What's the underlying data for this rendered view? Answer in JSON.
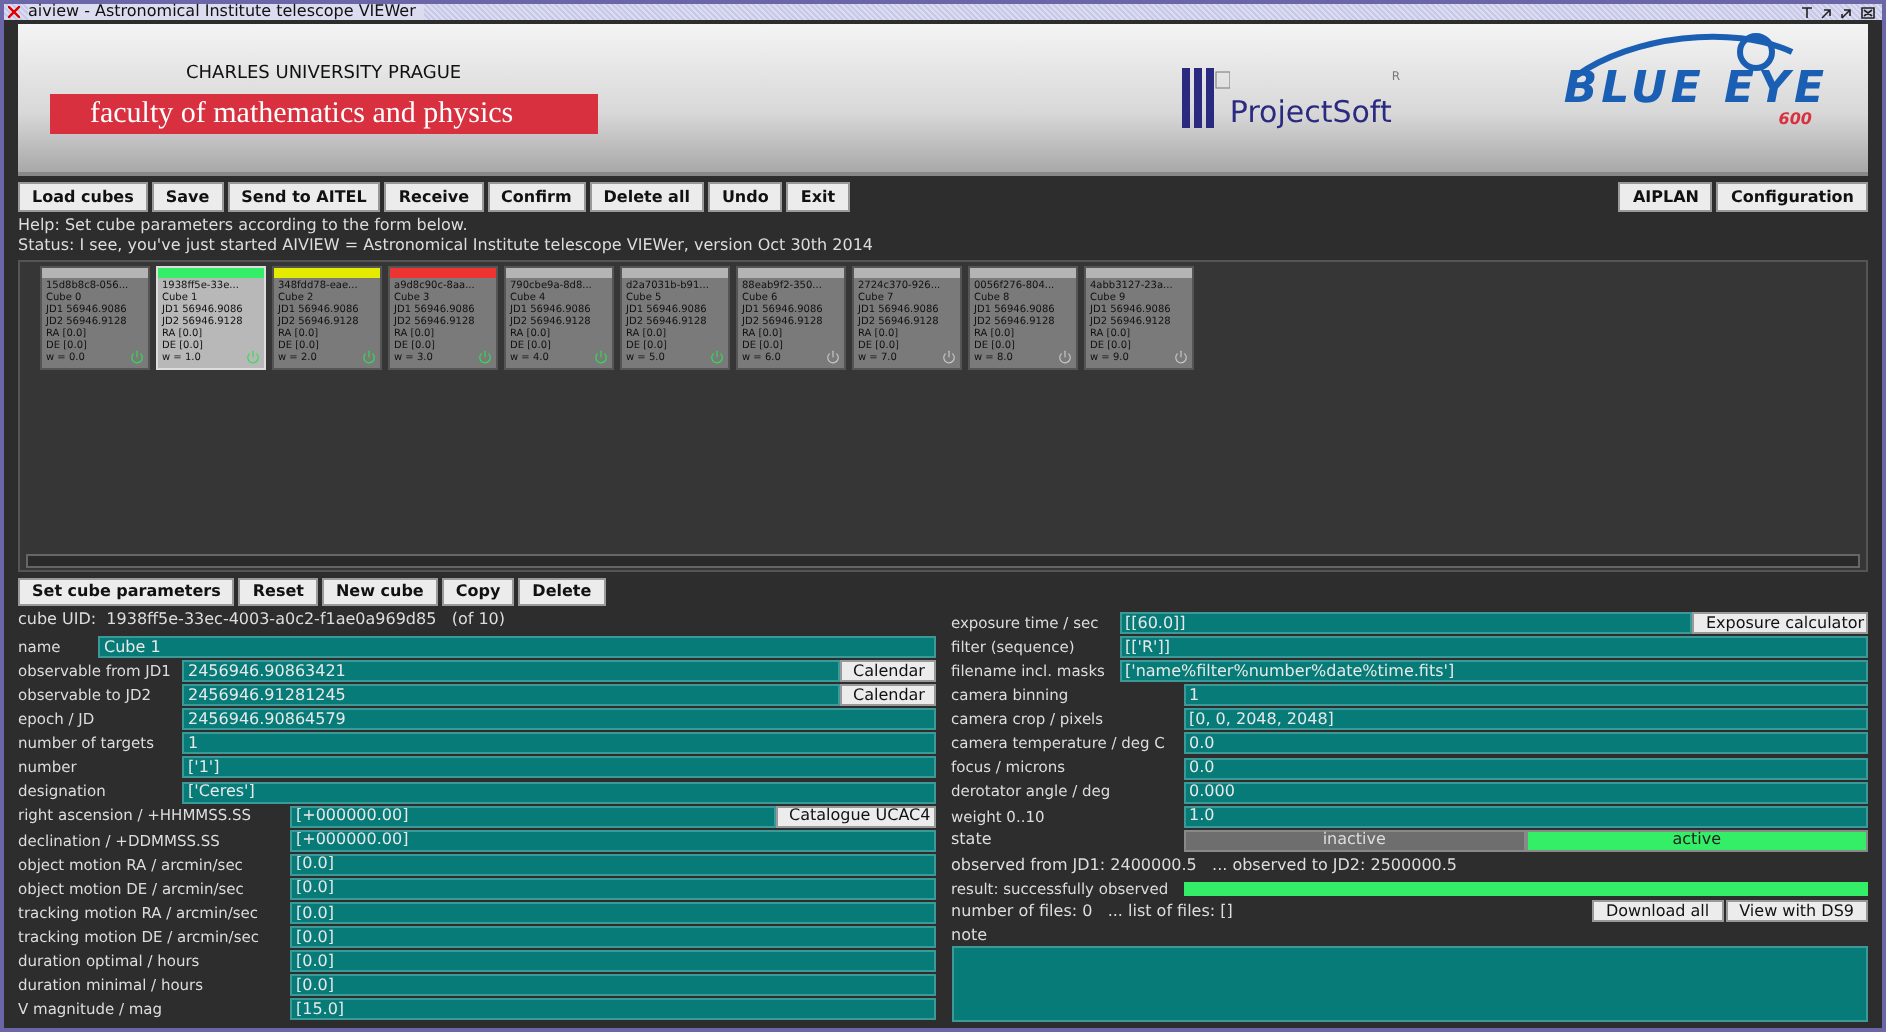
{
  "window": {
    "title": "aiview - Astronomical Institute telescope VIEWer"
  },
  "banner": {
    "university": "CHARLES UNIVERSITY PRAGUE",
    "faculty": "faculty of mathematics and physics",
    "projectsoft": "ProjectSoft",
    "projectsoft_mark": "R",
    "blue_eye": "BLUE EYE",
    "blue_eye_model": "600"
  },
  "toolbar": {
    "left": [
      "Load cubes",
      "Save",
      "Send to AITEL",
      "Receive",
      "Confirm",
      "Delete all",
      "Undo",
      "Exit"
    ],
    "right": [
      "AIPLAN",
      "Configuration"
    ]
  },
  "help": "Help:  Set cube parameters according to the form below.",
  "status": "Status:  I see, you've just started AIVIEW = Astronomical Institute telescope VIEWer, version Oct 30th 2014",
  "cubes": [
    {
      "id": "15d8b8c8-056...",
      "name": "Cube 0",
      "jd1": "JD1 56946.9086",
      "jd2": "JD2 56946.9128",
      "ra": "RA [0.0]",
      "de": "DE [0.0]",
      "w": "w = 0.0",
      "color": "#b4b4b4",
      "selected": false,
      "on": true
    },
    {
      "id": "1938ff5e-33e...",
      "name": "Cube 1",
      "jd1": "JD1 56946.9086",
      "jd2": "JD2 56946.9128",
      "ra": "RA [0.0]",
      "de": "DE [0.0]",
      "w": "w = 1.0",
      "color": "#33ee66",
      "selected": true,
      "on": true
    },
    {
      "id": "348fdd78-eae...",
      "name": "Cube 2",
      "jd1": "JD1 56946.9086",
      "jd2": "JD2 56946.9128",
      "ra": "RA [0.0]",
      "de": "DE [0.0]",
      "w": "w = 2.0",
      "color": "#e4ea00",
      "selected": false,
      "on": true
    },
    {
      "id": "a9d8c90c-8aa...",
      "name": "Cube 3",
      "jd1": "JD1 56946.9086",
      "jd2": "JD2 56946.9128",
      "ra": "RA [0.0]",
      "de": "DE [0.0]",
      "w": "w = 3.0",
      "color": "#ee3333",
      "selected": false,
      "on": true
    },
    {
      "id": "790cbe9a-8d8...",
      "name": "Cube 4",
      "jd1": "JD1 56946.9086",
      "jd2": "JD2 56946.9128",
      "ra": "RA [0.0]",
      "de": "DE [0.0]",
      "w": "w = 4.0",
      "color": "#b4b4b4",
      "selected": false,
      "on": true
    },
    {
      "id": "d2a7031b-b91...",
      "name": "Cube 5",
      "jd1": "JD1 56946.9086",
      "jd2": "JD2 56946.9128",
      "ra": "RA [0.0]",
      "de": "DE [0.0]",
      "w": "w = 5.0",
      "color": "#b4b4b4",
      "selected": false,
      "on": true
    },
    {
      "id": "88eab9f2-350...",
      "name": "Cube 6",
      "jd1": "JD1 56946.9086",
      "jd2": "JD2 56946.9128",
      "ra": "RA [0.0]",
      "de": "DE [0.0]",
      "w": "w = 6.0",
      "color": "#b4b4b4",
      "selected": false,
      "on": false
    },
    {
      "id": "2724c370-926...",
      "name": "Cube 7",
      "jd1": "JD1 56946.9086",
      "jd2": "JD2 56946.9128",
      "ra": "RA [0.0]",
      "de": "DE [0.0]",
      "w": "w = 7.0",
      "color": "#b4b4b4",
      "selected": false,
      "on": false
    },
    {
      "id": "0056f276-804...",
      "name": "Cube 8",
      "jd1": "JD1 56946.9086",
      "jd2": "JD2 56946.9128",
      "ra": "RA [0.0]",
      "de": "DE [0.0]",
      "w": "w = 8.0",
      "color": "#b4b4b4",
      "selected": false,
      "on": false
    },
    {
      "id": "4abb3127-23a...",
      "name": "Cube 9",
      "jd1": "JD1 56946.9086",
      "jd2": "JD2 56946.9128",
      "ra": "RA [0.0]",
      "de": "DE [0.0]",
      "w": "w = 9.0",
      "color": "#b4b4b4",
      "selected": false,
      "on": false
    }
  ],
  "cube_actions": [
    "Set cube parameters",
    "Reset",
    "New cube",
    "Copy",
    "Delete"
  ],
  "cube_uid": "cube UID:  1938ff5e-33ec-4003-a0c2-f1ae0a969d85   (of 10)",
  "left_fields": [
    {
      "label": "name",
      "value": "Cube 1"
    },
    {
      "label": "observable from JD1",
      "value": "2456946.90863421",
      "button": "Calendar"
    },
    {
      "label": "observable to JD2",
      "value": "2456946.91281245",
      "button": "Calendar"
    },
    {
      "label": "epoch / JD",
      "value": "2456946.90864579"
    },
    {
      "label": "number of targets",
      "value": "1"
    },
    {
      "label": "number",
      "value": "['1']"
    },
    {
      "label": "designation",
      "value": "['Ceres']"
    },
    {
      "label": "right ascension / +HHMMSS.SS",
      "value": "[+000000.00]",
      "button": "Catalogue UCAC4"
    },
    {
      "label": "declination / +DDMMSS.SS",
      "value": "[+000000.00]"
    },
    {
      "label": "object motion RA / arcmin/sec",
      "value": "[0.0]"
    },
    {
      "label": "object motion DE / arcmin/sec",
      "value": "[0.0]"
    },
    {
      "label": "tracking motion RA / arcmin/sec",
      "value": "[0.0]"
    },
    {
      "label": "tracking motion DE / arcmin/sec",
      "value": "[0.0]"
    },
    {
      "label": "duration optimal / hours",
      "value": "[0.0]"
    },
    {
      "label": "duration minimal / hours",
      "value": "[0.0]"
    },
    {
      "label": "V magnitude / mag",
      "value": "[15.0]"
    }
  ],
  "right_fields": [
    {
      "label": "exposure time / sec",
      "value": "[[60.0]]",
      "button": "Exposure calculator"
    },
    {
      "label": "filter (sequence)",
      "value": "[['R']]"
    },
    {
      "label": "filename incl. masks",
      "value": "['name%filter%number%date%time.fits']"
    },
    {
      "label": "camera binning",
      "value": "1"
    },
    {
      "label": "camera crop / pixels",
      "value": "[0, 0, 2048, 2048]"
    },
    {
      "label": "camera temperature / deg C",
      "value": "0.0"
    },
    {
      "label": "focus / microns",
      "value": "0.0"
    },
    {
      "label": "derotator angle / deg",
      "value": "0.000"
    },
    {
      "label": "weight 0..10",
      "value": "1.0"
    }
  ],
  "state": {
    "label": "state",
    "options": [
      {
        "label": "inactive",
        "selected": false
      },
      {
        "label": "active",
        "selected": true
      }
    ]
  },
  "observed": "observed from JD1: 2400000.5   ... observed to JD2: 2500000.5",
  "result": {
    "label": "result: successfully observed",
    "level": 1
  },
  "files": {
    "text": "number of files: 0   ... list of files: []",
    "buttons": [
      "Download all",
      "View with DS9"
    ]
  },
  "note": {
    "label": "note"
  }
}
